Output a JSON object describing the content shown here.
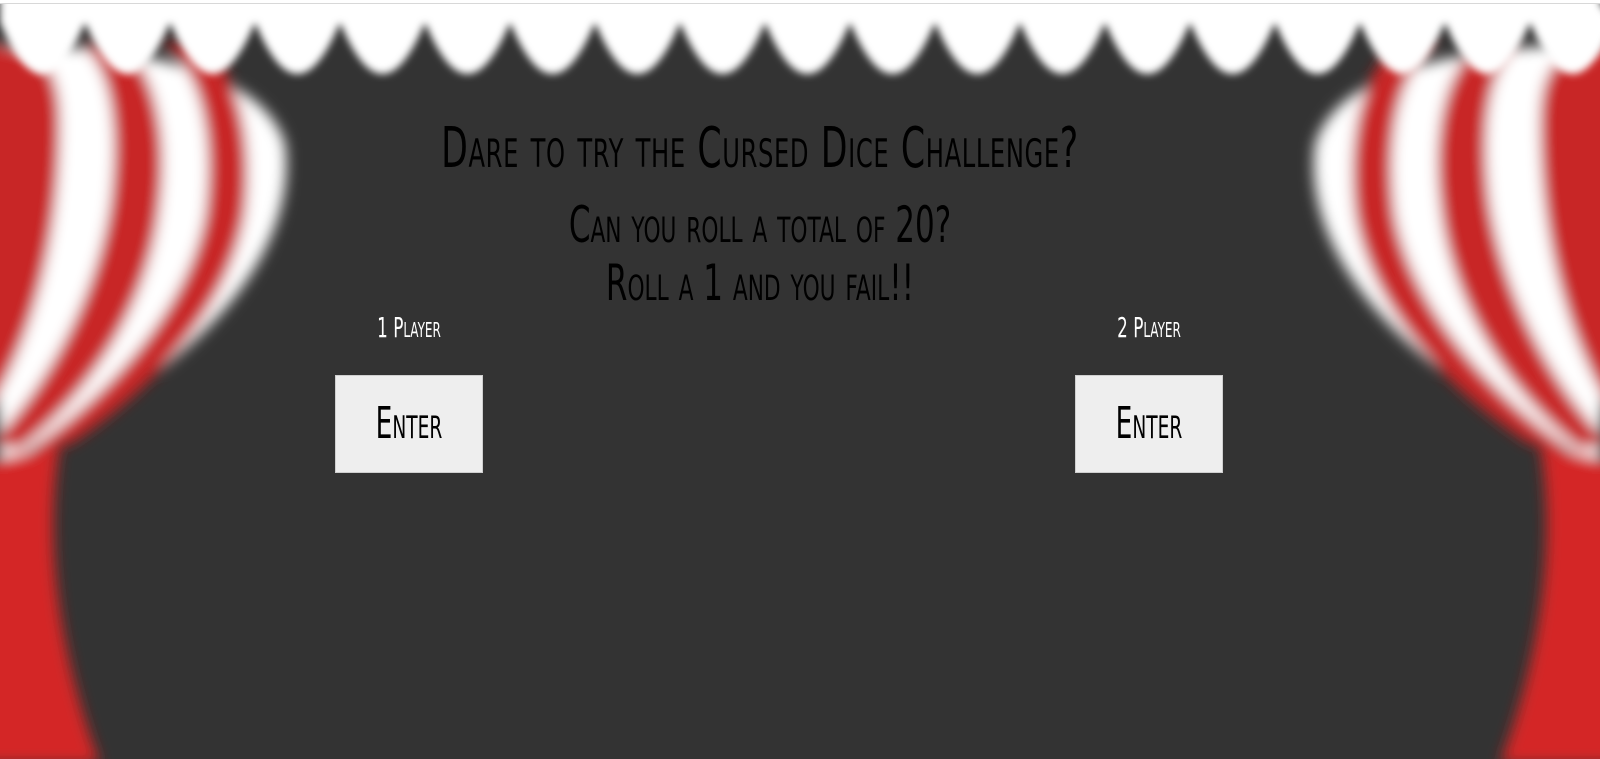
{
  "header": {
    "title": "Dare to try the Cursed Dice Challenge?",
    "subtitle_line1": "Can you roll a total of 20?",
    "subtitle_line2": "Roll a 1 and you fail!!"
  },
  "modes": [
    {
      "label": "1 Player",
      "button_label": "Enter"
    },
    {
      "label": "2 Player",
      "button_label": "Enter"
    }
  ],
  "colors": {
    "stage_background": "#333333",
    "curtain_red": "#d42828",
    "curtain_white": "#ffffff",
    "button_background": "#eeeeee",
    "label_text": "#ffffff",
    "title_text": "#000000"
  }
}
